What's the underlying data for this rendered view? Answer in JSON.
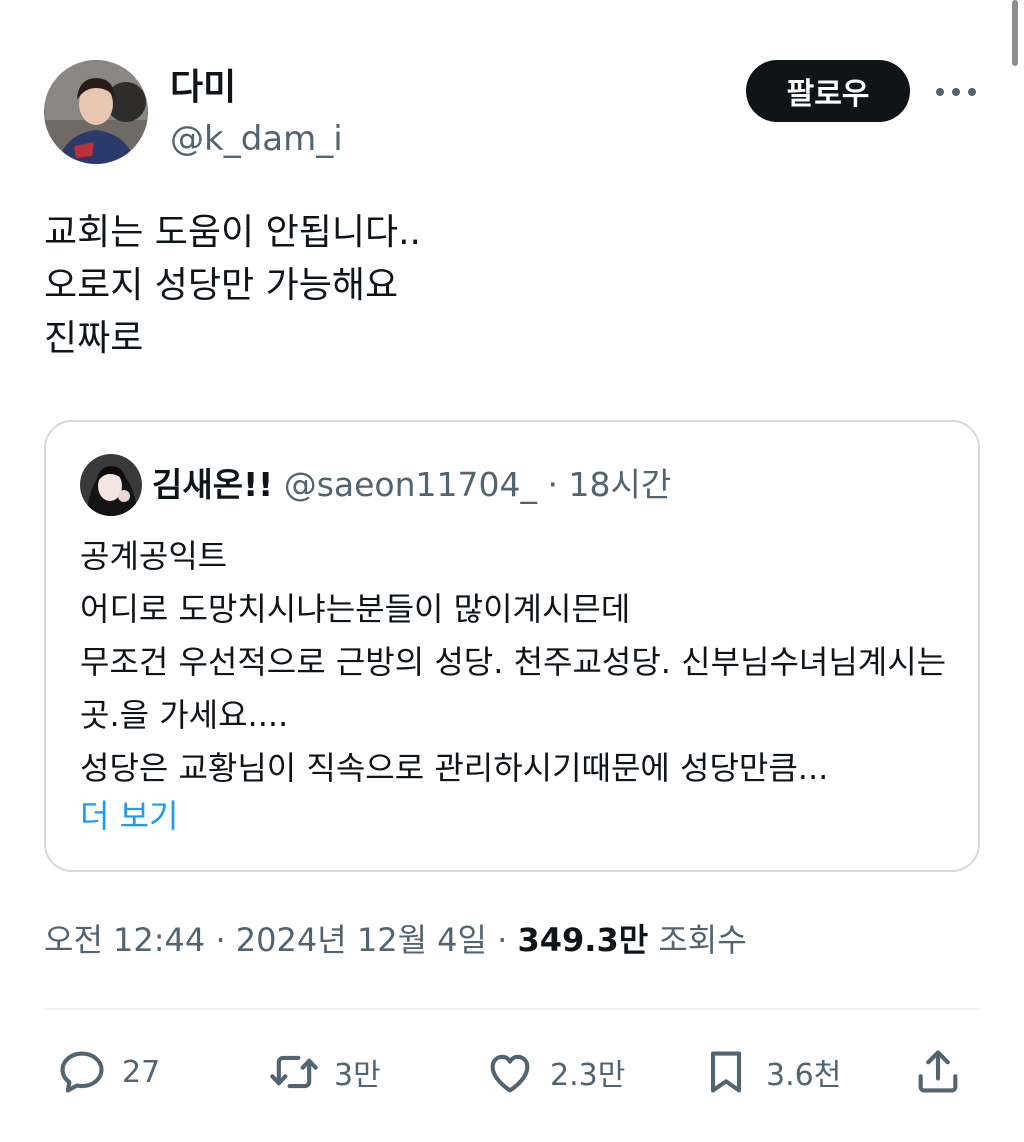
{
  "author": {
    "name": "다미",
    "handle": "@k_dam_i"
  },
  "follow_button": "팔로우",
  "more_icon": "more-horizontal-icon",
  "tweet": {
    "text": "교회는 도움이 안됩니다..\n오로지 성당만 가능해요\n진짜로"
  },
  "quoted": {
    "name": "김새온!!",
    "handle": "@saeon11704_",
    "separator": " · ",
    "time": "18시간",
    "text": "공계공익트\n어디로 도망치시냐는분들이 많이계시믄데\n무조건 우선적으로 근방의 성당. 천주교성당. 신부님수녀님계시는곳.을 가세요....\n성당은 교황님이 직속으로 관리하시기때문에 성당만큼...",
    "show_more": "더 보기"
  },
  "meta": {
    "time": "오전 12:44",
    "sep1": " · ",
    "date": "2024년 12월 4일",
    "sep2": " · ",
    "views_count": "349.3만",
    "views_label": " 조회수"
  },
  "actions": {
    "reply": {
      "icon": "reply-icon",
      "count": "27"
    },
    "retweet": {
      "icon": "retweet-icon",
      "count": "3만"
    },
    "like": {
      "icon": "heart-icon",
      "count": "2.3만"
    },
    "bookmark": {
      "icon": "bookmark-icon",
      "count": "3.6천"
    },
    "share": {
      "icon": "share-icon"
    }
  },
  "colors": {
    "text": "#0f1419",
    "secondary": "#536471",
    "link": "#1d9bf0",
    "border": "#cfd9de"
  }
}
